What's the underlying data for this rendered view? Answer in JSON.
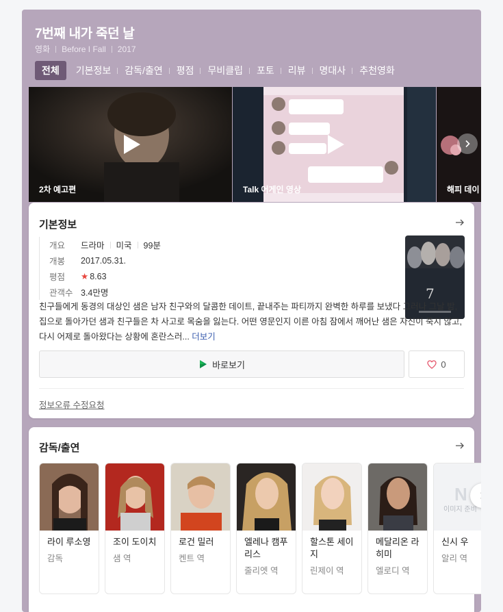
{
  "movie": {
    "title": "7번째 내가 죽던 날",
    "type": "영화",
    "original_title": "Before I Fall",
    "year": "2017"
  },
  "tabs": [
    "전체",
    "기본정보",
    "감독/출연",
    "평점",
    "무비클립",
    "포토",
    "리뷰",
    "명대사",
    "추천영화"
  ],
  "videos": [
    {
      "label": "2차 예고편",
      "icon": "play-icon"
    },
    {
      "label": "Talk 어게인 영상",
      "icon": "play-icon"
    },
    {
      "label": "해피 데이",
      "icon": "play-icon"
    }
  ],
  "basic_info": {
    "heading": "기본정보",
    "rows": {
      "summary": {
        "label": "개요",
        "genre": "드라마",
        "country": "미국",
        "runtime": "99분"
      },
      "release": {
        "label": "개봉",
        "value": "2017.05.31."
      },
      "rating": {
        "label": "평점",
        "star": "★",
        "value": "8.63"
      },
      "audience": {
        "label": "관객수",
        "value": "3.4만명"
      }
    },
    "description": "친구들에게 동경의 대상인 샘은 남자 친구와의 달콤한 데이트, 끝내주는 파티까지 완벽한 하루를 보냈다 그러나 그날 밤, 집으로 돌아가던 샘과 친구들은 차 사고로 목숨을 잃는다. 어떤 영문인지 이른 아침 잠에서 깨어난 샘은 자신이 죽지 않고, 다시 어제로 돌아왔다는 상황에 혼란스러...",
    "more": "더보기",
    "watch_button": "바로보기",
    "like_count": "0",
    "report_link": "정보오류 수정요청"
  },
  "cast": {
    "heading": "감독/출연",
    "people": [
      {
        "name": "라이 루소영",
        "role": "감독"
      },
      {
        "name": "조이 도이치",
        "role": "샘 역"
      },
      {
        "name": "로건 밀러",
        "role": "켄트 역"
      },
      {
        "name": "엘레나 캠푸리스",
        "role": "줄리엣 역"
      },
      {
        "name": "할스톤 세이지",
        "role": "린제이 역"
      },
      {
        "name": "메달리온 라히미",
        "role": "엘로디 역"
      },
      {
        "name": "신시 우",
        "role": "알리 역"
      }
    ],
    "no_image_text": "이미지 준비"
  },
  "colors": {
    "header_bg": "#b6a6bb",
    "tab_active": "#6f5a76",
    "star": "#e8463e",
    "like_heart": "#e5566c",
    "link": "#3a5dae"
  }
}
